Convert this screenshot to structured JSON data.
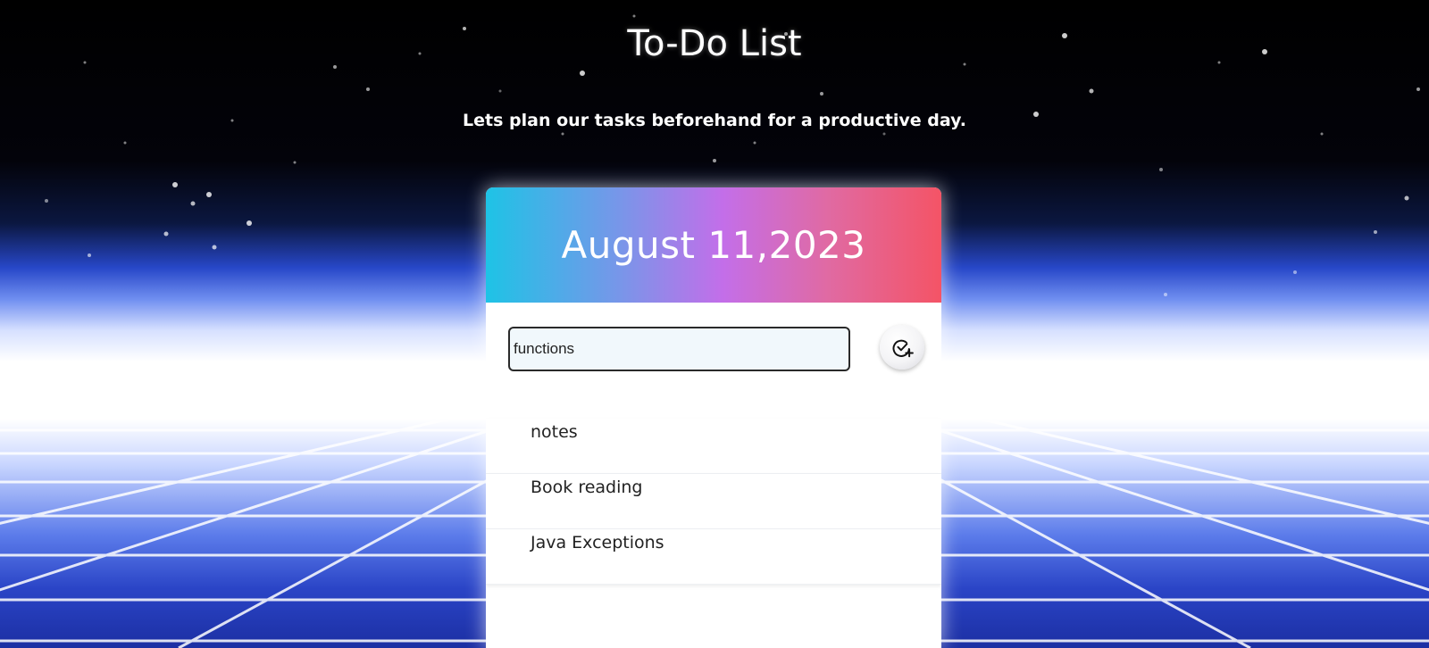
{
  "page": {
    "title": "To-Do List",
    "subtitle": "Lets plan our tasks beforehand for a productive day."
  },
  "card": {
    "date": "August 11,2023",
    "input": {
      "value": "functions"
    },
    "add_button_icon": "check-circle-plus-icon",
    "tasks": [
      {
        "label": "notes"
      },
      {
        "label": "Book reading"
      },
      {
        "label": "Java Exceptions"
      }
    ]
  },
  "colors": {
    "header_gradient": [
      "#1ec3e6",
      "#c36ee9",
      "#f45466"
    ],
    "input_bg": "#f1f8fc"
  }
}
